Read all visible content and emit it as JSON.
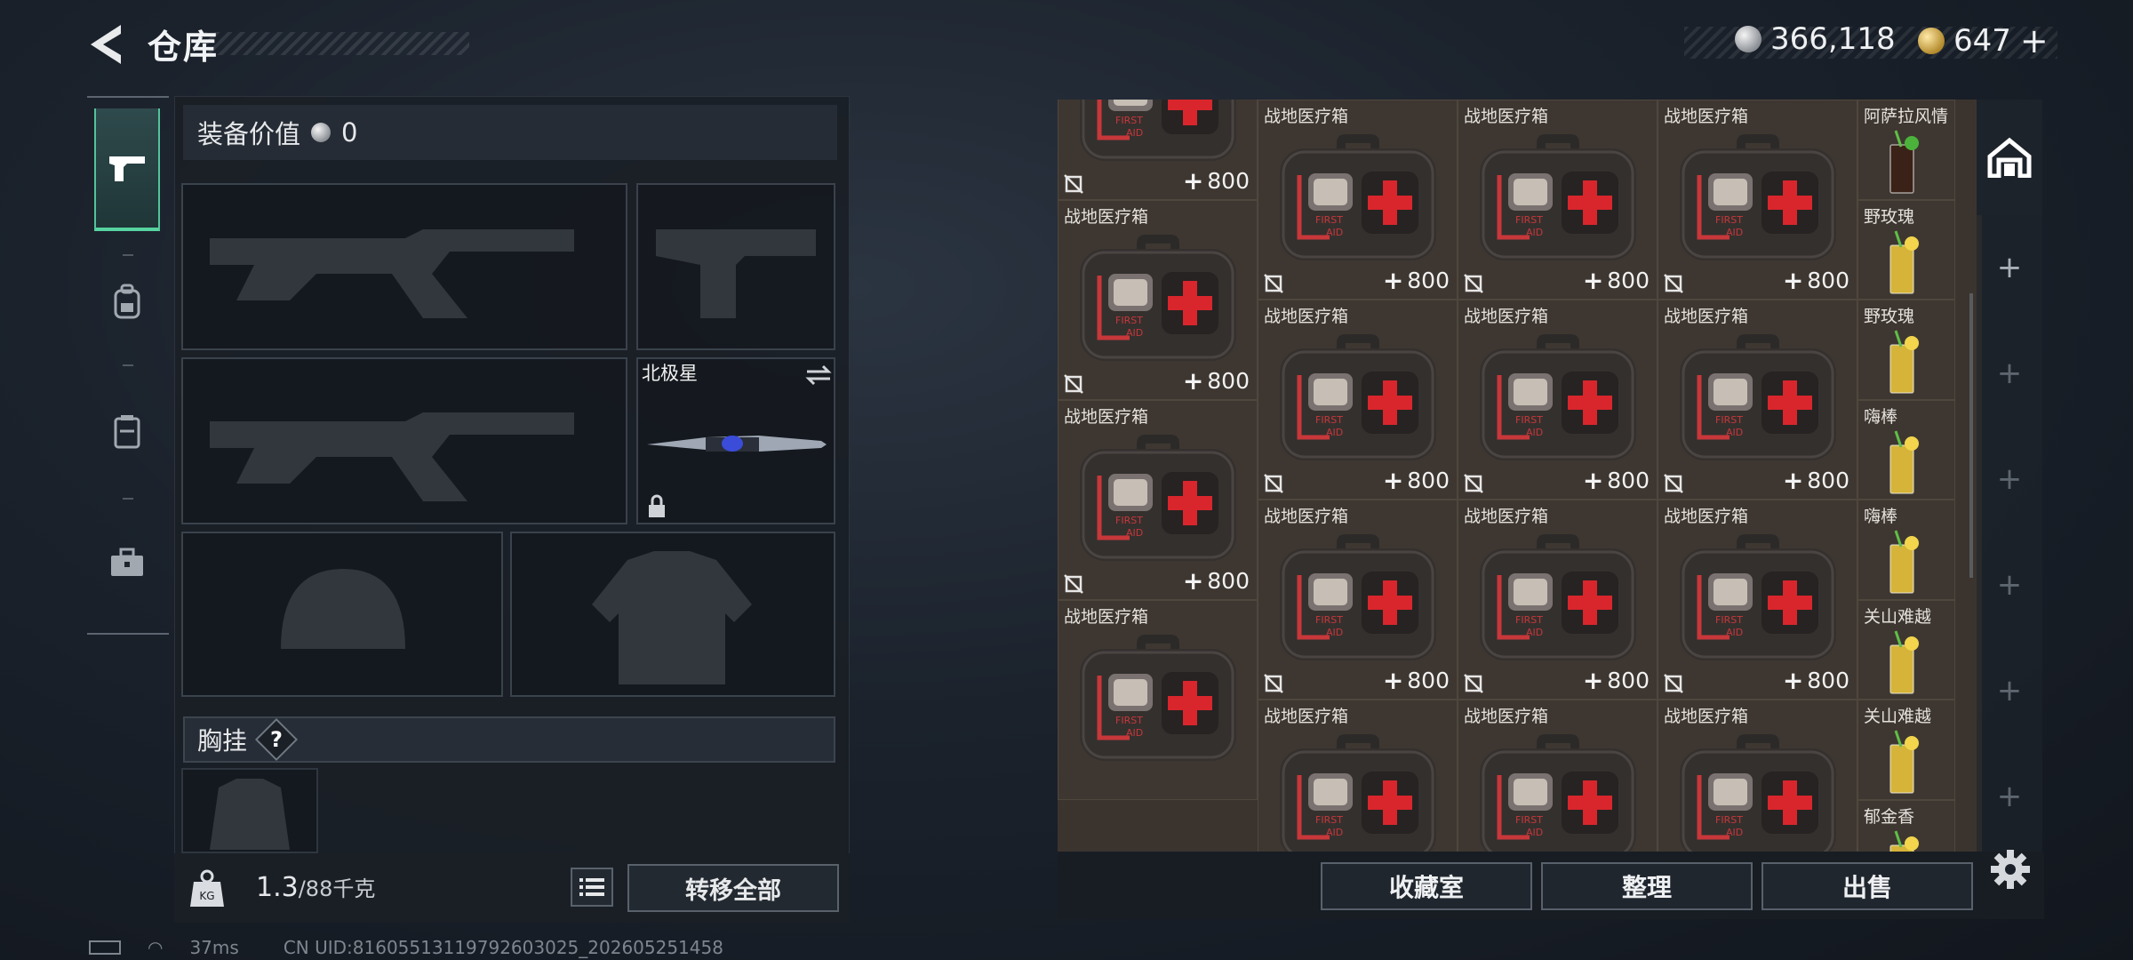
{
  "header": {
    "title": "仓库",
    "currency_silver": "366,118",
    "currency_gold": "647",
    "gold_add": "+"
  },
  "equipment": {
    "value_label": "装备价值",
    "value": "0",
    "knife_label": "北极星",
    "chest_label": "胸挂",
    "help": "?"
  },
  "footer_left": {
    "weight": "1.3",
    "weight_cap": "/88千克",
    "transfer_all": "转移全部"
  },
  "status": {
    "ping": "37ms",
    "uid": "CN UID:816055131197926030​25_202605251458"
  },
  "storage": {
    "columns": [
      {
        "cells": [
          {
            "name": "战地医疗箱",
            "value": "800"
          },
          {
            "name": "战地医疗箱",
            "value": "800"
          },
          {
            "name": "战地医疗箱",
            "value": "800"
          },
          {
            "name": "战地医疗箱",
            "value": ""
          }
        ]
      },
      {
        "cells": [
          {
            "name": "",
            "value": "800"
          },
          {
            "name": "战地医疗箱",
            "value": "800"
          },
          {
            "name": "战地医疗箱",
            "value": "800"
          },
          {
            "name": "战地医疗箱",
            "value": "800"
          },
          {
            "name": "战地医疗箱",
            "value": ""
          }
        ]
      },
      {
        "cells": [
          {
            "name": "",
            "value": "800"
          },
          {
            "name": "战地医疗箱",
            "value": "800"
          },
          {
            "name": "战地医疗箱",
            "value": "800"
          },
          {
            "name": "战地医疗箱",
            "value": "800"
          },
          {
            "name": "战地医疗箱",
            "value": ""
          }
        ]
      },
      {
        "cells": [
          {
            "name": "",
            "value": "800"
          },
          {
            "name": "战地医疗箱",
            "value": "800"
          },
          {
            "name": "战地医疗箱",
            "value": "800"
          },
          {
            "name": "战地医疗箱",
            "value": "800"
          },
          {
            "name": "战地医疗箱",
            "value": ""
          }
        ]
      }
    ],
    "drinks": [
      "阿萨拉风情",
      "野玫瑰",
      "野玫瑰",
      "嗨棒",
      "嗨棒",
      "关山难越",
      "关山难越",
      "郁金香"
    ],
    "medkit_text_1": "FIRST",
    "medkit_text_2": "AID"
  },
  "buttons": {
    "collection": "收藏室",
    "organize": "整理",
    "sell": "出售"
  },
  "mini_bar": [
    "+",
    "+",
    "+",
    "+",
    "+",
    "+"
  ]
}
